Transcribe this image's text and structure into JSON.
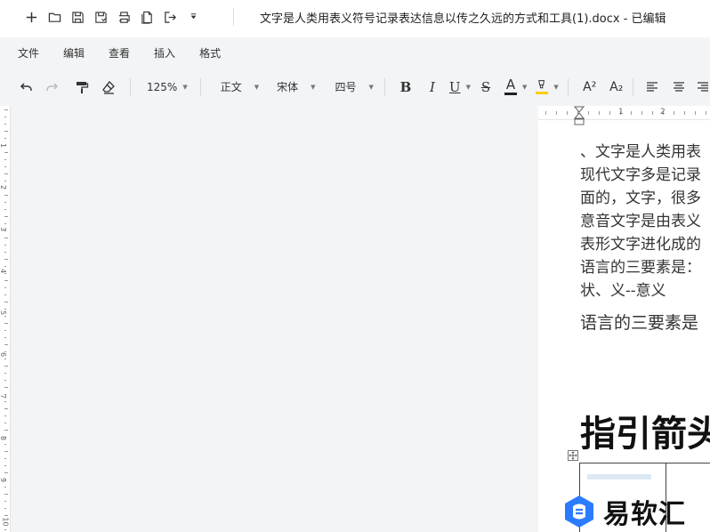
{
  "window": {
    "title": "文字是人类用表义符号记录表达信息以传之久远的方式和工具(1).docx - 已编辑"
  },
  "menu": {
    "items": [
      "文件",
      "编辑",
      "查看",
      "插入",
      "格式"
    ]
  },
  "toolbar": {
    "zoom": "125%",
    "style": "正文",
    "font": "宋体",
    "size": "四号",
    "bold": "B",
    "italic": "I",
    "underline": "U",
    "strike": "S",
    "font_color": "A",
    "superscript": "A²",
    "subscript": "A₂"
  },
  "ruler": {
    "numbers": [
      "1",
      "2"
    ],
    "vnumbers": [
      "1",
      "2",
      "3",
      "4",
      "5",
      "6",
      "7",
      "8",
      "9",
      "10"
    ]
  },
  "document": {
    "lines": [
      "、文字是人类用表",
      "现代文字多是记录",
      "面的，文字，很多",
      "意音文字是由表义",
      "表形文字进化成的",
      "语言的三要素是：",
      "状、义--意义"
    ],
    "para2": "语言的三要素是",
    "heading": "指引箭头"
  },
  "watermark": {
    "text": "易软汇"
  },
  "colors": {
    "accent_blue": "#2b7bff",
    "font_color_bar": "#222222",
    "highlight_bar": "#f5d000"
  }
}
